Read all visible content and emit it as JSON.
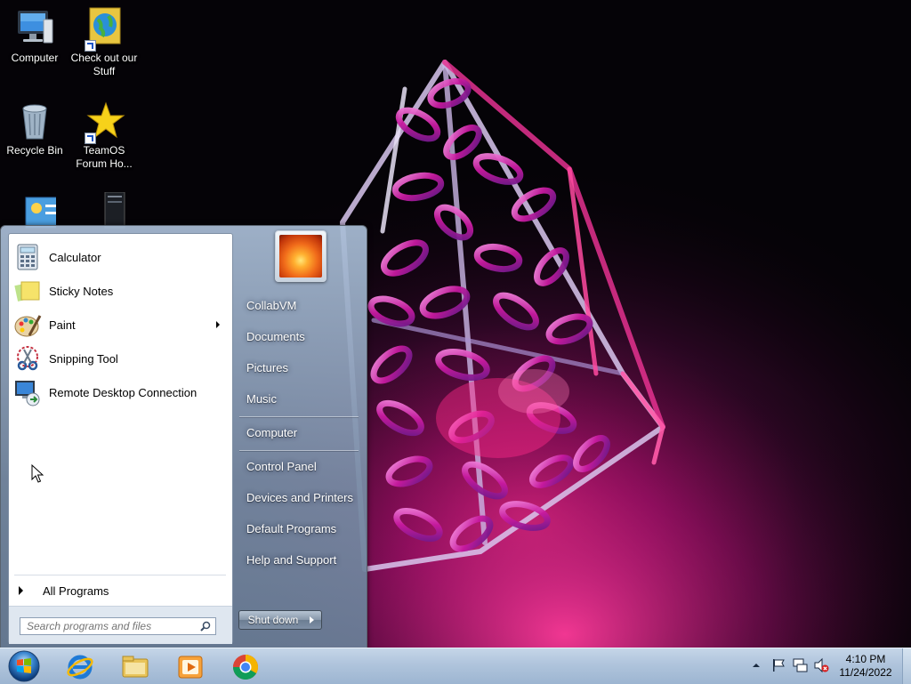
{
  "desktop": {
    "icons": [
      {
        "label": "Computer"
      },
      {
        "label": "Check out our Stuff"
      },
      {
        "label": "Recycle Bin"
      },
      {
        "label": "TeamOS Forum Ho..."
      },
      {
        "label": ""
      },
      {
        "label": ""
      }
    ]
  },
  "start_menu": {
    "programs": [
      {
        "label": "Calculator",
        "icon": "calculator-icon"
      },
      {
        "label": "Sticky Notes",
        "icon": "sticky-notes-icon"
      },
      {
        "label": "Paint",
        "icon": "paint-icon",
        "has_submenu": true
      },
      {
        "label": "Snipping Tool",
        "icon": "snipping-tool-icon"
      },
      {
        "label": "Remote Desktop Connection",
        "icon": "remote-desktop-icon"
      }
    ],
    "all_programs_label": "All Programs",
    "search_placeholder": "Search programs and files",
    "right_items": [
      {
        "label": "CollabVM"
      },
      {
        "label": "Documents"
      },
      {
        "label": "Pictures"
      },
      {
        "label": "Music"
      },
      {
        "label": "Computer"
      },
      {
        "label": "Control Panel"
      },
      {
        "label": "Devices and Printers"
      },
      {
        "label": "Default Programs"
      },
      {
        "label": "Help and Support"
      }
    ],
    "shutdown_label": "Shut down"
  },
  "taskbar": {
    "pinned": [
      "internet-explorer-icon",
      "windows-explorer-icon",
      "media-player-icon",
      "chrome-icon"
    ],
    "clock": {
      "time": "4:10 PM",
      "date": "11/24/2022"
    },
    "tray_icons": [
      "show-hidden-icons-chevron",
      "action-center-flag-icon",
      "network-icon",
      "volume-muted-icon"
    ]
  },
  "colors": {
    "accent_pink": "#e8107a",
    "taskbar": "#afc4dc",
    "start_menu_right": "#8fa3bb"
  }
}
